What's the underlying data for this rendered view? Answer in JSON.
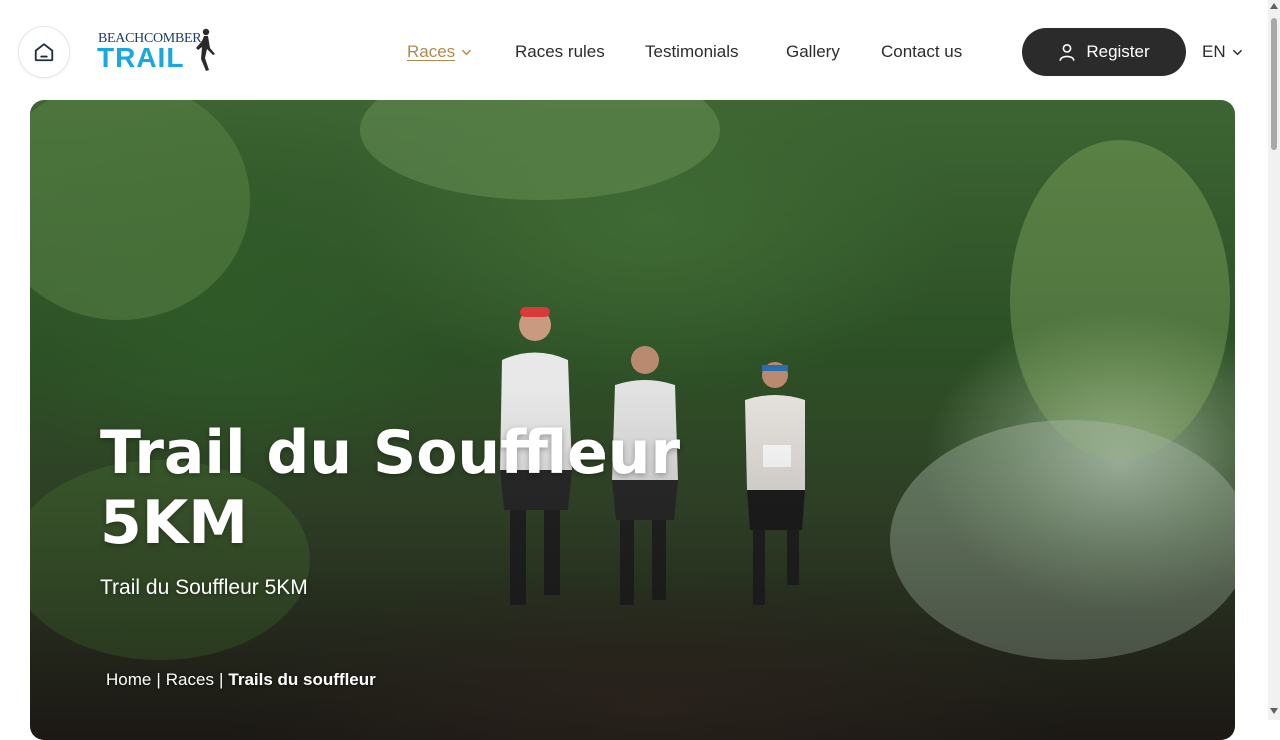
{
  "header": {
    "logo": {
      "line1": "BEACHCOMBER",
      "line2": "TRAIL"
    },
    "nav": [
      {
        "label": "Races",
        "active": true,
        "has_dropdown": true
      },
      {
        "label": "Races rules"
      },
      {
        "label": "Testimonials"
      },
      {
        "label": "Gallery"
      },
      {
        "label": "Contact us"
      }
    ],
    "register_label": "Register",
    "language": "EN",
    "icons": {
      "home": "home-icon",
      "user": "user-icon",
      "chevron": "chevron-down-icon"
    }
  },
  "hero": {
    "title": "Trail du Souffleur 5KM",
    "subtitle": "Trail du Souffleur 5KM",
    "breadcrumb": [
      {
        "label": "Home"
      },
      {
        "label": "Races"
      },
      {
        "label": "Trails du souffleur",
        "current": true
      }
    ],
    "breadcrumb_separator": "|"
  },
  "colors": {
    "accent": "#b08a4e",
    "register_bg": "#2b2b2b",
    "logo_blue": "#18a8e0",
    "logo_navy": "#1c3d6d"
  }
}
